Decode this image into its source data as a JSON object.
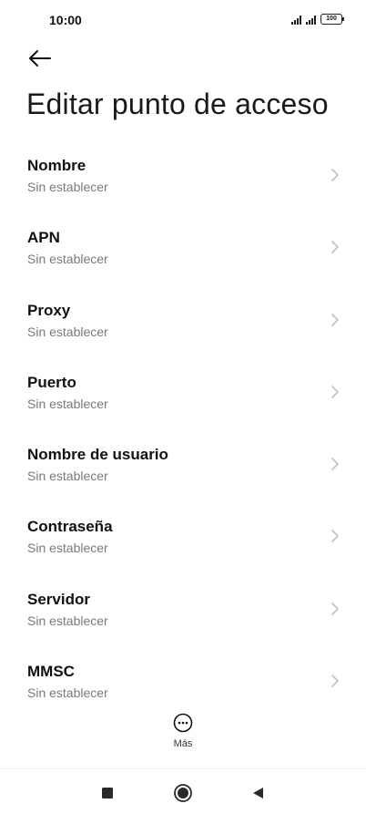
{
  "status_bar": {
    "time": "10:00",
    "battery": "100",
    "icons": [
      "signal-icon",
      "signal-icon",
      "battery-icon"
    ]
  },
  "header": {
    "back_icon": "arrow-left-icon",
    "title": "Editar punto de acceso"
  },
  "settings": {
    "items": [
      {
        "label": "Nombre",
        "value": "Sin establecer"
      },
      {
        "label": "APN",
        "value": "Sin establecer"
      },
      {
        "label": "Proxy",
        "value": "Sin establecer"
      },
      {
        "label": "Puerto",
        "value": "Sin establecer"
      },
      {
        "label": "Nombre de usuario",
        "value": "Sin establecer"
      },
      {
        "label": "Contraseña",
        "value": "Sin establecer"
      },
      {
        "label": "Servidor",
        "value": "Sin establecer"
      },
      {
        "label": "MMSC",
        "value": "Sin establecer"
      }
    ]
  },
  "bottom_action": {
    "icon": "more-horizontal-circle-icon",
    "label": "Más"
  },
  "nav_bar": {
    "icons": [
      "recent-apps-icon",
      "home-icon",
      "back-icon"
    ]
  },
  "colors": {
    "background": "#ffffff",
    "label": "#111111",
    "secondary_text": "#7a7a7a",
    "chevron": "#c0c0c0"
  }
}
